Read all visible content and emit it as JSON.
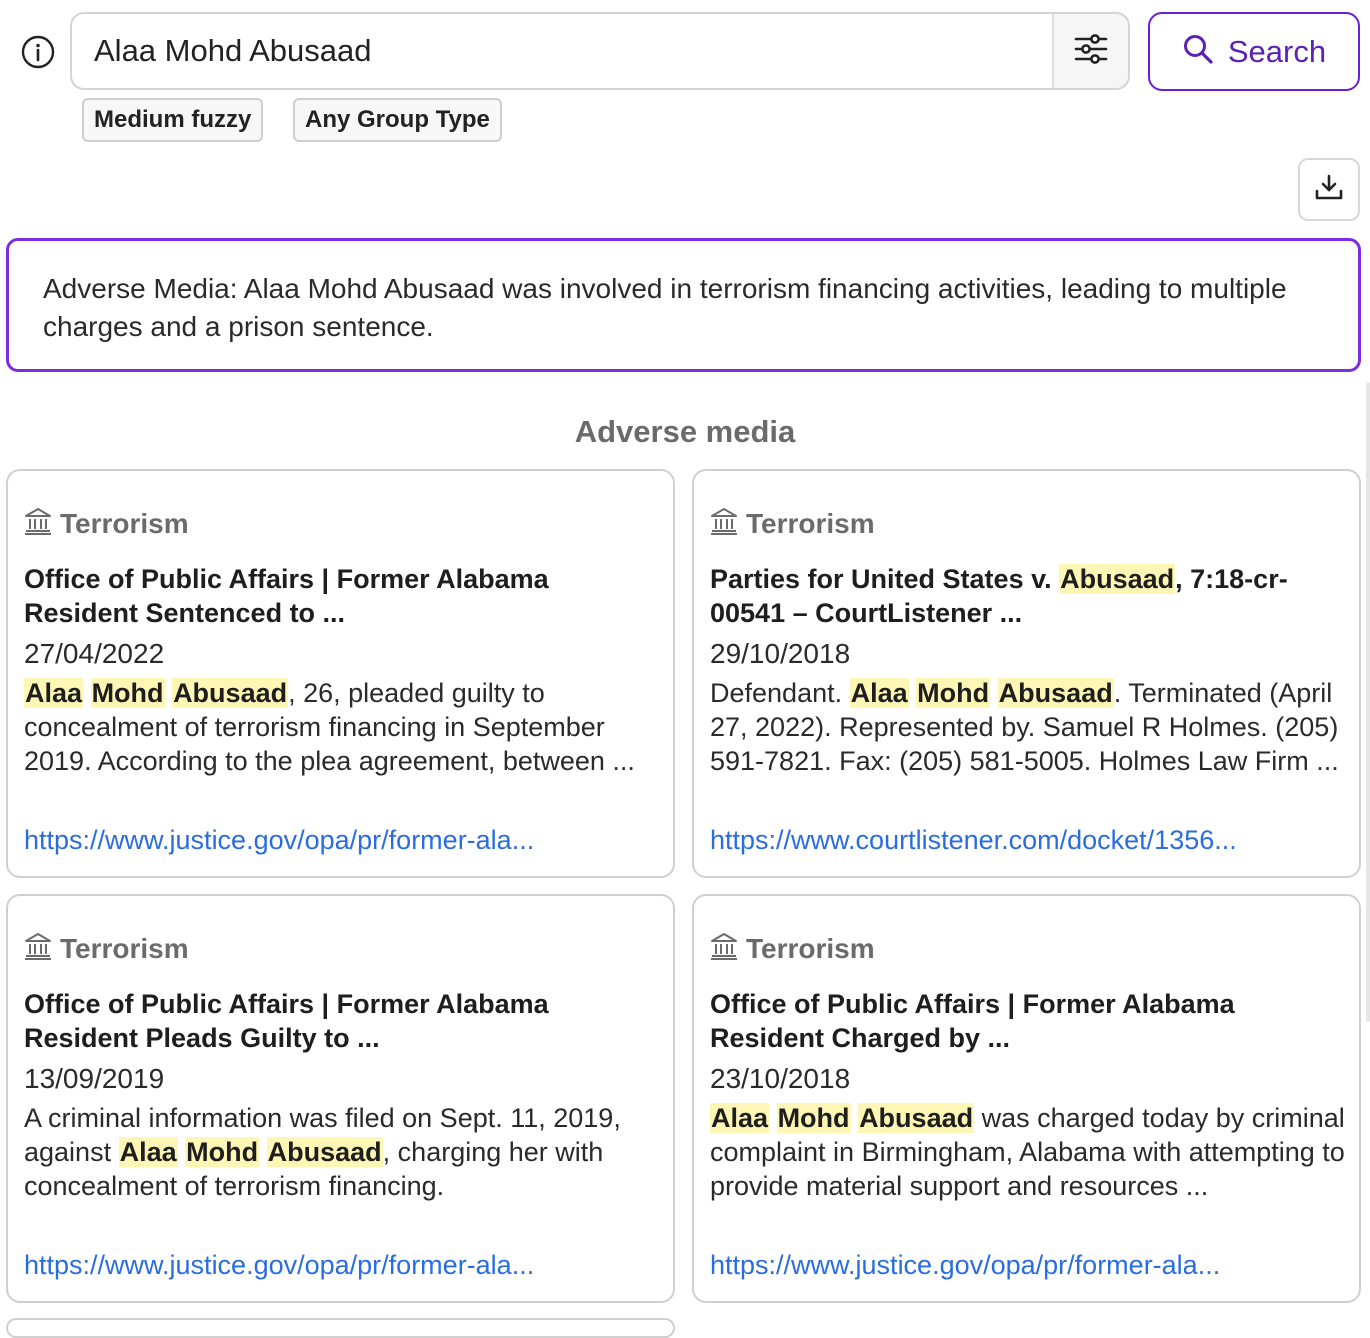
{
  "search": {
    "query": "Alaa Mohd Abusaad",
    "button_label": "Search"
  },
  "filters": [
    {
      "label": "Medium fuzzy"
    },
    {
      "label": "Any Group Type"
    }
  ],
  "summary": "Adverse Media: Alaa Mohd Abusaad was involved in terrorism financing activities, leading to multiple charges and a prison sentence.",
  "section_title": "Adverse media",
  "highlight_terms": [
    "Alaa",
    "Mohd",
    "Abusaad"
  ],
  "colors": {
    "accent": "#6a1fd6",
    "highlight": "#fdf6b4",
    "link": "#2a6de0"
  },
  "cards": [
    {
      "category": "Terrorism",
      "category_icon": "institution-icon",
      "title": "Office of Public Affairs | Former Alabama Resident Sentenced to ...",
      "date": "27/04/2022",
      "snippet": "Alaa Mohd Abusaad, 26, pleaded guilty to concealment of terrorism financing in September 2019. According to the plea agreement, between ...",
      "url": "https://www.justice.gov/opa/pr/former-ala..."
    },
    {
      "category": "Terrorism",
      "category_icon": "institution-icon",
      "title": "Parties for United States v. Abusaad, 7:18-cr-00541 – CourtListener ...",
      "date": "29/10/2018",
      "snippet": "Defendant. Alaa Mohd Abusaad. Terminated (April 27, 2022). Represented by. Samuel R Holmes. (205) 591-7821. Fax: (205) 581-5005. Holmes Law Firm ...",
      "url": "https://www.courtlistener.com/docket/1356..."
    },
    {
      "category": "Terrorism",
      "category_icon": "institution-icon",
      "title": "Office of Public Affairs | Former Alabama Resident Pleads Guilty to ...",
      "date": "13/09/2019",
      "snippet": "A criminal information was filed on Sept. 11, 2019, against Alaa Mohd Abusaad, charging her with concealment of terrorism financing.",
      "url": "https://www.justice.gov/opa/pr/former-ala..."
    },
    {
      "category": "Terrorism",
      "category_icon": "institution-icon",
      "title": "Office of Public Affairs | Former Alabama Resident Charged by ...",
      "date": "23/10/2018",
      "snippet": "Alaa Mohd Abusaad was charged today by criminal complaint in Birmingham, Alabama with attempting to provide material support and resources ...",
      "url": "https://www.justice.gov/opa/pr/former-ala..."
    }
  ]
}
